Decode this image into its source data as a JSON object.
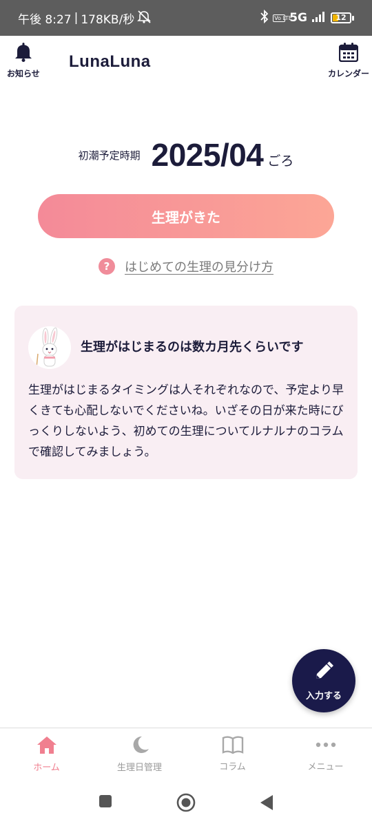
{
  "status_bar": {
    "time_text": "午後 8:27",
    "network_speed": "178KB/秒",
    "network_type": "5G",
    "volte": "Vo LTE",
    "battery_level": "12",
    "icons": [
      "mute-icon",
      "bluetooth-icon",
      "signal-icon",
      "battery-icon"
    ]
  },
  "header": {
    "notice_label": "お知らせ",
    "logo_text": "LunaLuna",
    "calendar_label": "カレンダー"
  },
  "prediction": {
    "label": "初潮予定時期",
    "date": "2025/04",
    "suffix": "ごろ"
  },
  "period_button_label": "生理がきた",
  "help_link_text": "はじめての生理の見分け方",
  "help_icon_glyph": "?",
  "info_card": {
    "title": "生理がはじまるのは数カ月先くらいです",
    "body": "生理がはじまるタイミングは人それぞれなので、予定より早くきても心配しないでくださいね。いざその日が来た時にびっくりしないよう、初めての生理についてルナルナのコラムで確認してみましょう。"
  },
  "fab_label": "入力する",
  "bottom_nav": {
    "items": [
      {
        "label": "ホーム",
        "icon": "home-icon",
        "active": true
      },
      {
        "label": "生理日管理",
        "icon": "moon-icon",
        "active": false
      },
      {
        "label": "コラム",
        "icon": "book-icon",
        "active": false
      },
      {
        "label": "メニュー",
        "icon": "more-icon",
        "active": false
      }
    ]
  },
  "colors": {
    "accent_pink": "#f07f8f",
    "navy": "#1a1a4a",
    "card_bg": "#f9eef3",
    "button_gradient_start": "#f48a98",
    "button_gradient_end": "#fca696"
  }
}
